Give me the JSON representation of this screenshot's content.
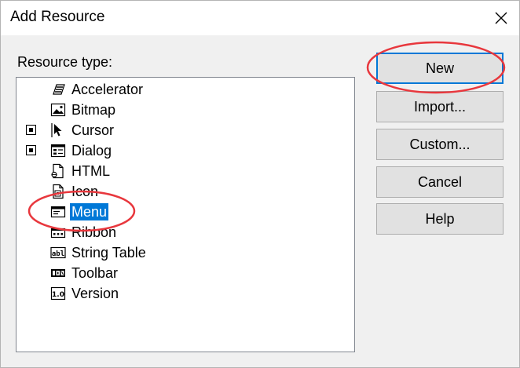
{
  "window": {
    "title": "Add Resource"
  },
  "resource_type_label": "Resource type:",
  "tree_items": [
    {
      "label": "Accelerator",
      "icon": "accelerator-icon",
      "expandable": false,
      "selected": false
    },
    {
      "label": "Bitmap",
      "icon": "bitmap-icon",
      "expandable": false,
      "selected": false
    },
    {
      "label": "Cursor",
      "icon": "cursor-icon",
      "expandable": true,
      "selected": false
    },
    {
      "label": "Dialog",
      "icon": "dialog-icon",
      "expandable": true,
      "selected": false
    },
    {
      "label": "HTML",
      "icon": "html-icon",
      "expandable": false,
      "selected": false
    },
    {
      "label": "Icon",
      "icon": "icon-resource-icon",
      "expandable": false,
      "selected": false
    },
    {
      "label": "Menu",
      "icon": "menu-icon",
      "expandable": false,
      "selected": true
    },
    {
      "label": "Ribbon",
      "icon": "ribbon-icon",
      "expandable": false,
      "selected": false
    },
    {
      "label": "String Table",
      "icon": "string-table-icon",
      "expandable": false,
      "selected": false
    },
    {
      "label": "Toolbar",
      "icon": "toolbar-icon",
      "expandable": false,
      "selected": false
    },
    {
      "label": "Version",
      "icon": "version-icon",
      "expandable": false,
      "selected": false
    }
  ],
  "icon_text": {
    "string_table": "abl",
    "version": "1.0"
  },
  "buttons": {
    "new": "New",
    "import": "Import...",
    "custom": "Custom...",
    "cancel": "Cancel",
    "help": "Help"
  },
  "colors": {
    "selection": "#0078d7",
    "annotation": "#e8373d"
  }
}
